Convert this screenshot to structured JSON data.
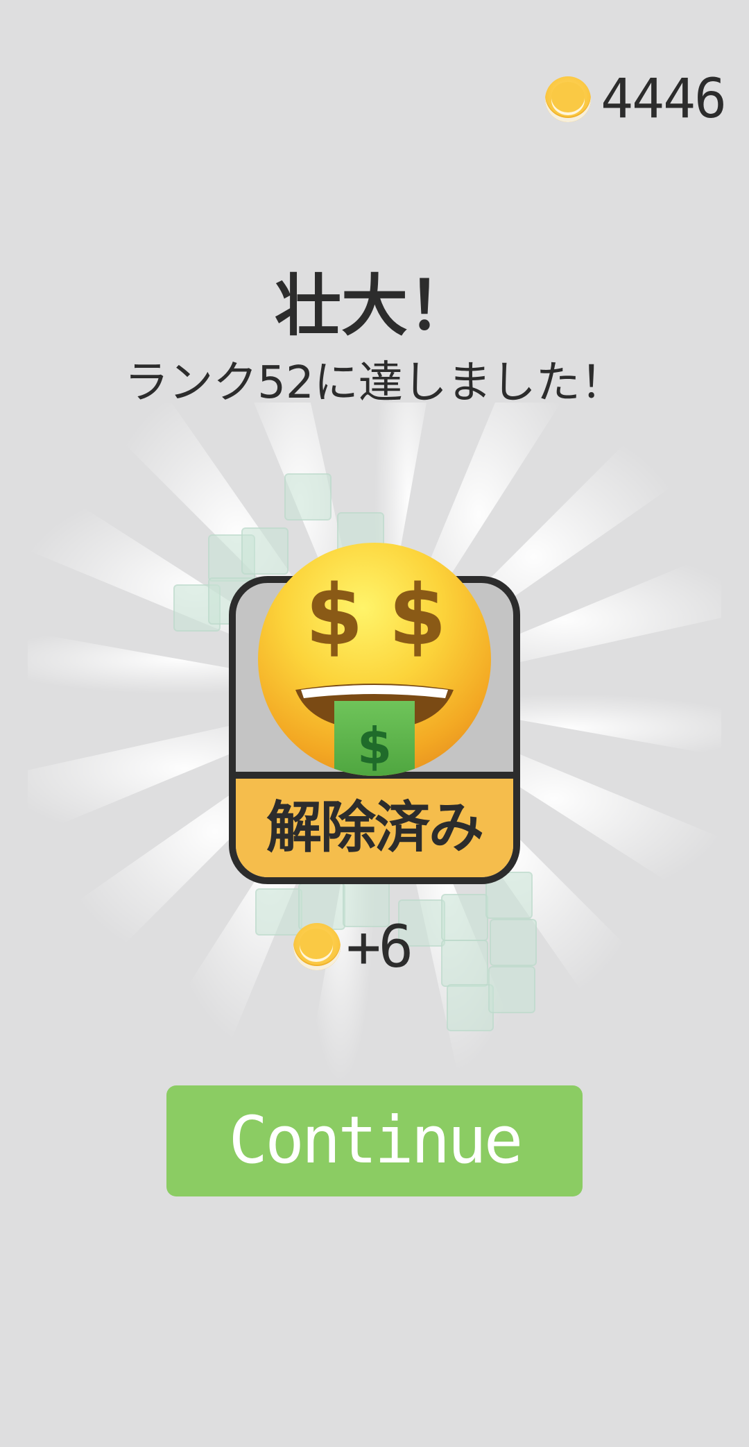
{
  "header": {
    "coin_icon": "gold-coin-icon",
    "coin_total": "4446"
  },
  "message": {
    "title": "壮大！",
    "subtitle": "ランク52に達しました！"
  },
  "badge": {
    "emoji_icon": "money-mouth-face-icon",
    "status_label": "解除済み",
    "colors": {
      "top": "#c4c4c4",
      "bottom": "#f5bd4c",
      "border": "#2c2c2c"
    }
  },
  "reward": {
    "coin_icon": "gold-coin-icon",
    "amount": "+6"
  },
  "actions": {
    "continue_label": "Continue",
    "continue_color": "#8bcc63"
  }
}
